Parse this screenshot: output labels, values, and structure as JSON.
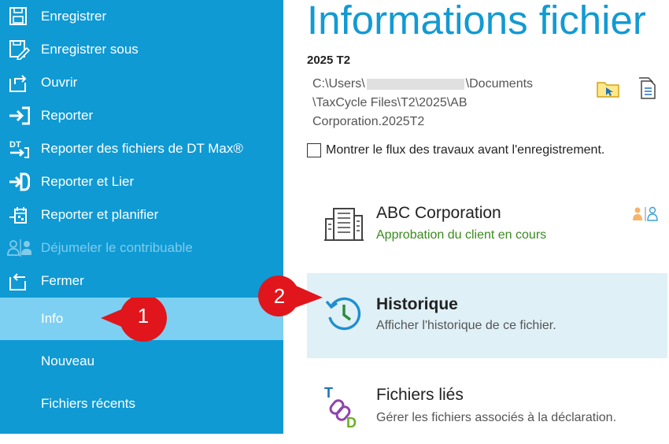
{
  "sidebar": {
    "items": [
      {
        "label": "Enregistrer",
        "icon": "save-icon"
      },
      {
        "label": "Enregistrer sous",
        "icon": "save-as-icon"
      },
      {
        "label": "Ouvrir",
        "icon": "open-icon"
      },
      {
        "label": "Reporter",
        "icon": "carry-forward-icon"
      },
      {
        "label": "Reporter des fichiers de DT Max®",
        "icon": "dt-max-icon"
      },
      {
        "label": "Reporter et Lier",
        "icon": "carry-forward-link-icon"
      },
      {
        "label": "Reporter et planifier",
        "icon": "carry-forward-schedule-icon"
      },
      {
        "label": "Déjumeler le contribuable",
        "icon": "unlink-taxpayer-icon",
        "disabled": true
      },
      {
        "label": "Fermer",
        "icon": "close-file-icon"
      },
      {
        "label": "Info",
        "selected": true
      },
      {
        "label": "Nouveau"
      },
      {
        "label": "Fichiers récents"
      }
    ]
  },
  "main": {
    "title": "Informations fichier",
    "file_name": "2025 T2",
    "path": {
      "line1_start": "C:\\Users\\",
      "line1_end": "\\Documents",
      "line2": "\\TaxCycle Files\\T2\\2025\\AB",
      "line3": "Corporation.2025T2"
    },
    "workflow_checkbox": {
      "label": "Montrer le flux des travaux avant l'enregistrement.",
      "checked": false
    },
    "cards": {
      "client": {
        "title": "ABC Corporation",
        "subtitle": "Approbation du client en cours",
        "subtitle_color": "#3a8a1e"
      },
      "history": {
        "title": "Historique",
        "subtitle": "Afficher l'historique de ce fichier."
      },
      "linked": {
        "title": "Fichiers liés",
        "subtitle": "Gérer les fichiers associés à la déclaration."
      }
    }
  },
  "callouts": [
    "1",
    "2"
  ],
  "colors": {
    "sidebar_bg": "#0f9ad4",
    "selected_bg": "#7dd0f1",
    "title": "#129ad3",
    "callout_red": "#e0161c",
    "history_bg": "#dff0f7"
  }
}
